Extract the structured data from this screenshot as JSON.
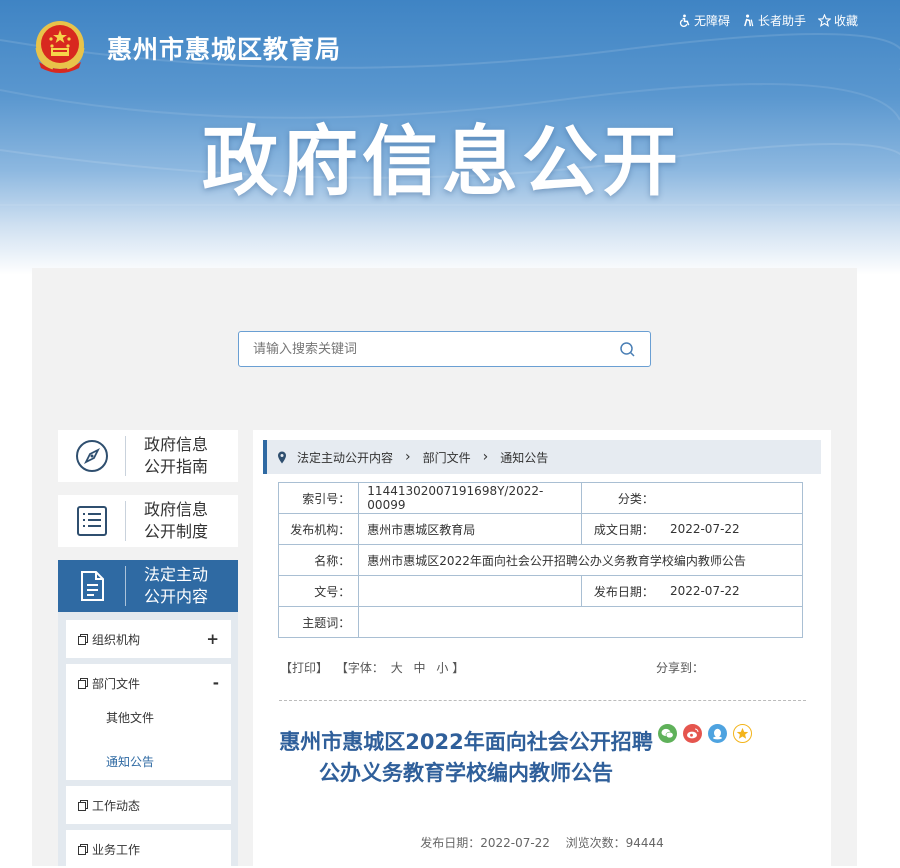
{
  "header": {
    "site_name": "惠州市惠城区教育局",
    "banner_title": "政府信息公开",
    "links": [
      {
        "label": "无障碍",
        "icon": "accessibility-icon"
      },
      {
        "label": "长者助手",
        "icon": "elder-assist-icon"
      },
      {
        "label": "收藏",
        "icon": "star-icon"
      }
    ]
  },
  "search": {
    "placeholder": "请输入搜索关键词"
  },
  "sidebar": {
    "cards": [
      {
        "line1": "政府信息",
        "line2": "公开指南",
        "icon": "compass-icon",
        "active": false
      },
      {
        "line1": "政府信息",
        "line2": "公开制度",
        "icon": "list-icon",
        "active": false
      },
      {
        "line1": "法定主动",
        "line2": "公开内容",
        "icon": "document-icon",
        "active": true
      }
    ],
    "sub_items": [
      {
        "label": "组织机构",
        "sign": "+"
      },
      {
        "label": "部门文件",
        "sign": "-",
        "children": [
          "其他文件",
          "通知公告"
        ]
      },
      {
        "label": "工作动态"
      },
      {
        "label": "业务工作"
      }
    ]
  },
  "breadcrumb": [
    "法定主动公开内容",
    "部门文件",
    "通知公告"
  ],
  "meta": {
    "index_label": "索引号：",
    "index_value": "11441302007191698Y/2022-00099",
    "category_label": "分类：",
    "category_value": "",
    "org_label": "发布机构：",
    "org_value": "惠州市惠城区教育局",
    "created_label": "成文日期：",
    "created_value": "2022-07-22",
    "name_label": "名称：",
    "name_value": "惠州市惠城区2022年面向社会公开招聘公办义务教育学校编内教师公告",
    "docno_label": "文号：",
    "docno_value": "",
    "publish_label": "发布日期：",
    "publish_value": "2022-07-22",
    "subject_label": "主题词：",
    "subject_value": ""
  },
  "tools": {
    "print": "【打印】",
    "font": "【字体：",
    "large": "大",
    "medium": "中",
    "small": "小",
    "close": "】",
    "share": "分享到："
  },
  "article": {
    "title": "惠州市惠城区2022年面向社会公开招聘公办义务教育学校编内教师公告",
    "publish_info": "发布日期：2022-07-22",
    "views_info": "浏览次数：94444"
  },
  "colors": {
    "brand": "#2f6aa3",
    "title": "#2f5f9a",
    "wechat": "#5fb15a",
    "weibo": "#e5554e",
    "qq": "#4ea3e0",
    "qzone": "#f3b41b"
  }
}
